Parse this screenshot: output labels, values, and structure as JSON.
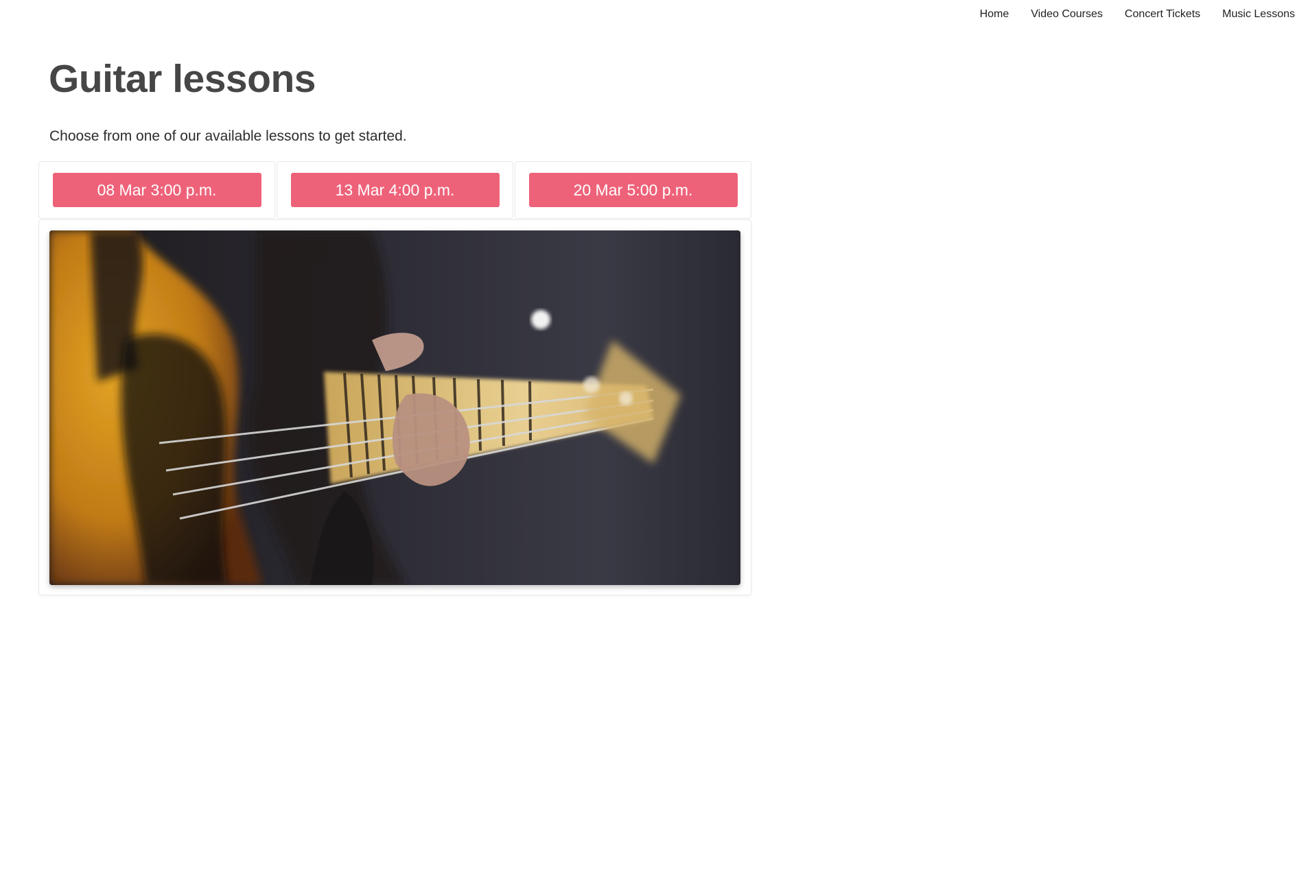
{
  "nav": {
    "items": [
      {
        "label": "Home"
      },
      {
        "label": "Video Courses"
      },
      {
        "label": "Concert Tickets"
      },
      {
        "label": "Music Lessons"
      }
    ]
  },
  "header": {
    "title": "Guitar lessons",
    "intro": "Choose from one of our available lessons to get started."
  },
  "lessons": [
    {
      "label": "08 Mar 3:00 p.m."
    },
    {
      "label": "13 Mar 4:00 p.m."
    },
    {
      "label": "20 Mar 5:00 p.m."
    }
  ],
  "colors": {
    "button": "#ee6279",
    "title": "#464646"
  },
  "image": {
    "subject": "close-up photo of a hand playing a bass guitar fretboard"
  }
}
